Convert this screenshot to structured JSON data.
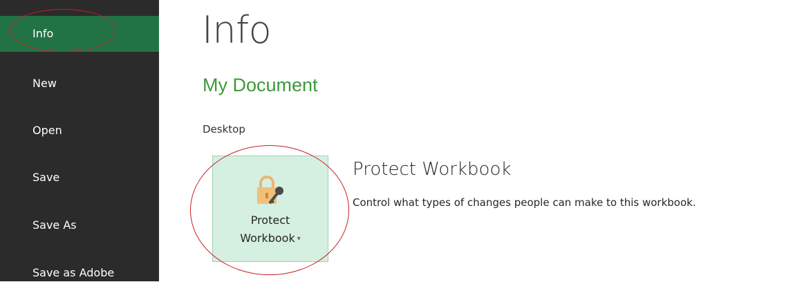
{
  "sidebar": {
    "items": [
      {
        "label": "Info",
        "active": true
      },
      {
        "label": "New"
      },
      {
        "label": "Open"
      },
      {
        "label": "Save"
      },
      {
        "label": "Save As"
      },
      {
        "label": "Save as Adobe"
      }
    ]
  },
  "main": {
    "page_title": "Info",
    "document_title": "My Document",
    "document_location": "Desktop",
    "protect": {
      "button_line1": "Protect",
      "button_line2": "Workbook",
      "dropdown_glyph": "▾",
      "icon": "lock-key-icon",
      "section_title": "Protect Workbook",
      "description": "Control what types of changes people can make to this workbook."
    }
  },
  "colors": {
    "sidebar_bg": "#2b2b2b",
    "active_nav": "#217346",
    "document_title": "#3a9a3a",
    "tile_bg": "#d5efe0",
    "callout": "#cc1f1f"
  }
}
